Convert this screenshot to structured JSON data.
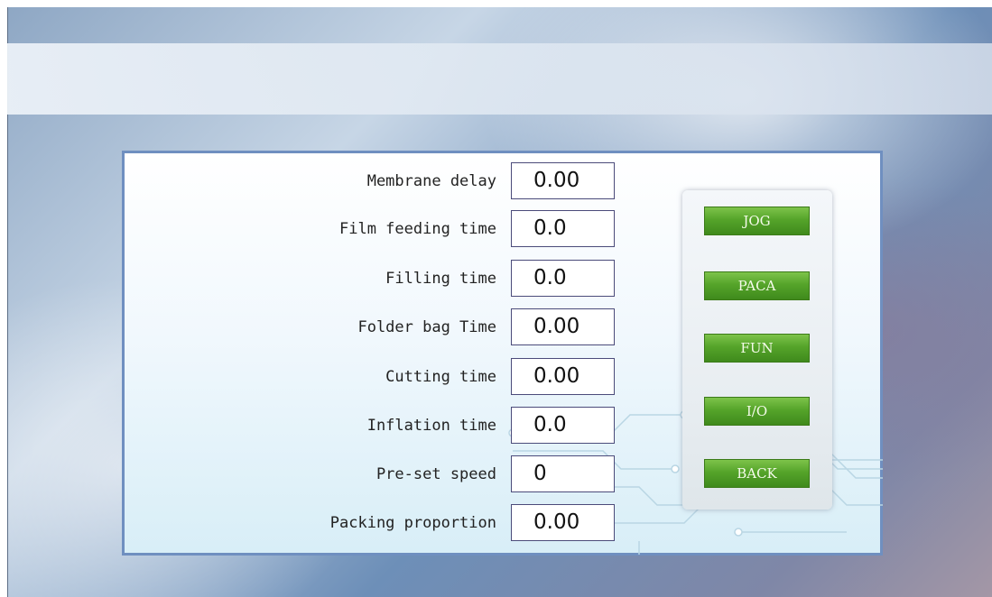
{
  "params": [
    {
      "label": "Membrane delay",
      "value": "0.00"
    },
    {
      "label": "Film feeding time",
      "value": "0.0"
    },
    {
      "label": "Filling time",
      "value": "0.0"
    },
    {
      "label": "Folder bag Time",
      "value": "0.00"
    },
    {
      "label": "Cutting time",
      "value": "0.00"
    },
    {
      "label": "Inflation time",
      "value": "0.0"
    },
    {
      "label": "Pre-set speed",
      "value": "0"
    },
    {
      "label": "Packing proportion",
      "value": "0.00"
    }
  ],
  "buttons": {
    "jog": "JOG",
    "paca": "PACA",
    "fun": "FUN",
    "io": "I/O",
    "back": "BACK"
  },
  "colors": {
    "button_green": "#55a42a",
    "panel_border": "#6f8fc0"
  }
}
